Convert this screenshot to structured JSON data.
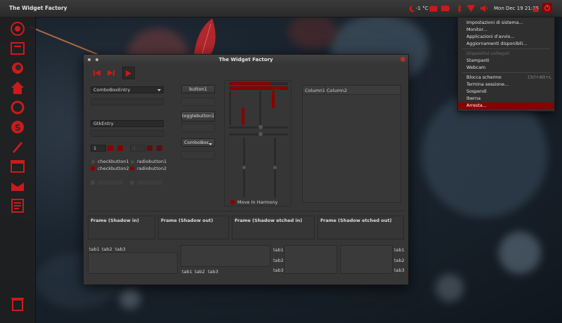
{
  "topbar": {
    "app_title": "The Widget Factory",
    "temperature": "-1 °C",
    "datetime": "Mon Dec 19 21:35"
  },
  "icons": {
    "weather": "moon-icon",
    "mail": "mail-icon",
    "battery": "battery-icon",
    "bluetooth": "bluetooth-icon",
    "network": "network-icon",
    "volume": "volume-icon",
    "user": "user-icon",
    "power": "power-icon"
  },
  "accent_color": "#c8161d",
  "launcher": {
    "items": [
      "dash-icon",
      "workspace-icon",
      "firefox-icon",
      "home-folder-icon",
      "opera-icon",
      "skype-icon",
      "pen-icon",
      "calendar-icon",
      "mail-app-icon",
      "document-icon"
    ],
    "trash": "trash-icon"
  },
  "window": {
    "title": "The Widget Factory",
    "combo_entry": "ComboBoxEntry",
    "gtk_entry": "GtkEntry",
    "spin1_value": "1",
    "spin2_value": "1",
    "checkbutton1": "checkbutton1",
    "checkbutton2": "checkbutton2",
    "radiobutton1": "radiobutton1",
    "radiobutton2": "radiobutton2",
    "button1": "button1",
    "togglebutton1": "togglebutton1",
    "combobox": "ComboBox",
    "move_in_harmony": "Move In Harmony",
    "column1": "Column1",
    "column2": "Column2",
    "frames": [
      "Frame (Shadow in)",
      "Frame (Shadow out)",
      "Frame (Shadow etched in)",
      "Frame (Shadow etched out)"
    ],
    "tabs": [
      "tab1",
      "tab2",
      "tab3"
    ]
  },
  "progress": {
    "bar1": 0.7,
    "bar2": 1.0
  },
  "menu": {
    "items": [
      {
        "label": "Impostazioni di sistema...",
        "shortcut": "",
        "state": "normal"
      },
      {
        "label": "Monitor...",
        "shortcut": "",
        "state": "normal"
      },
      {
        "label": "Applicazioni d'avvio...",
        "shortcut": "",
        "state": "normal"
      },
      {
        "label": "Aggiornamenti disponibili...",
        "shortcut": "",
        "state": "normal"
      },
      {
        "label": "Dispositivi collegati",
        "shortcut": "",
        "state": "disabled"
      },
      {
        "label": "Stampanti",
        "shortcut": "",
        "state": "normal"
      },
      {
        "label": "Webcam",
        "shortcut": "",
        "state": "normal"
      },
      {
        "label": "Blocca schermo",
        "shortcut": "Ctrl+Alt+L",
        "state": "normal"
      },
      {
        "label": "Termina sessione...",
        "shortcut": "",
        "state": "normal"
      },
      {
        "label": "Sospendi",
        "shortcut": "",
        "state": "normal"
      },
      {
        "label": "Iberna",
        "shortcut": "",
        "state": "normal"
      },
      {
        "label": "Arresta...",
        "shortcut": "",
        "state": "selected"
      }
    ]
  }
}
